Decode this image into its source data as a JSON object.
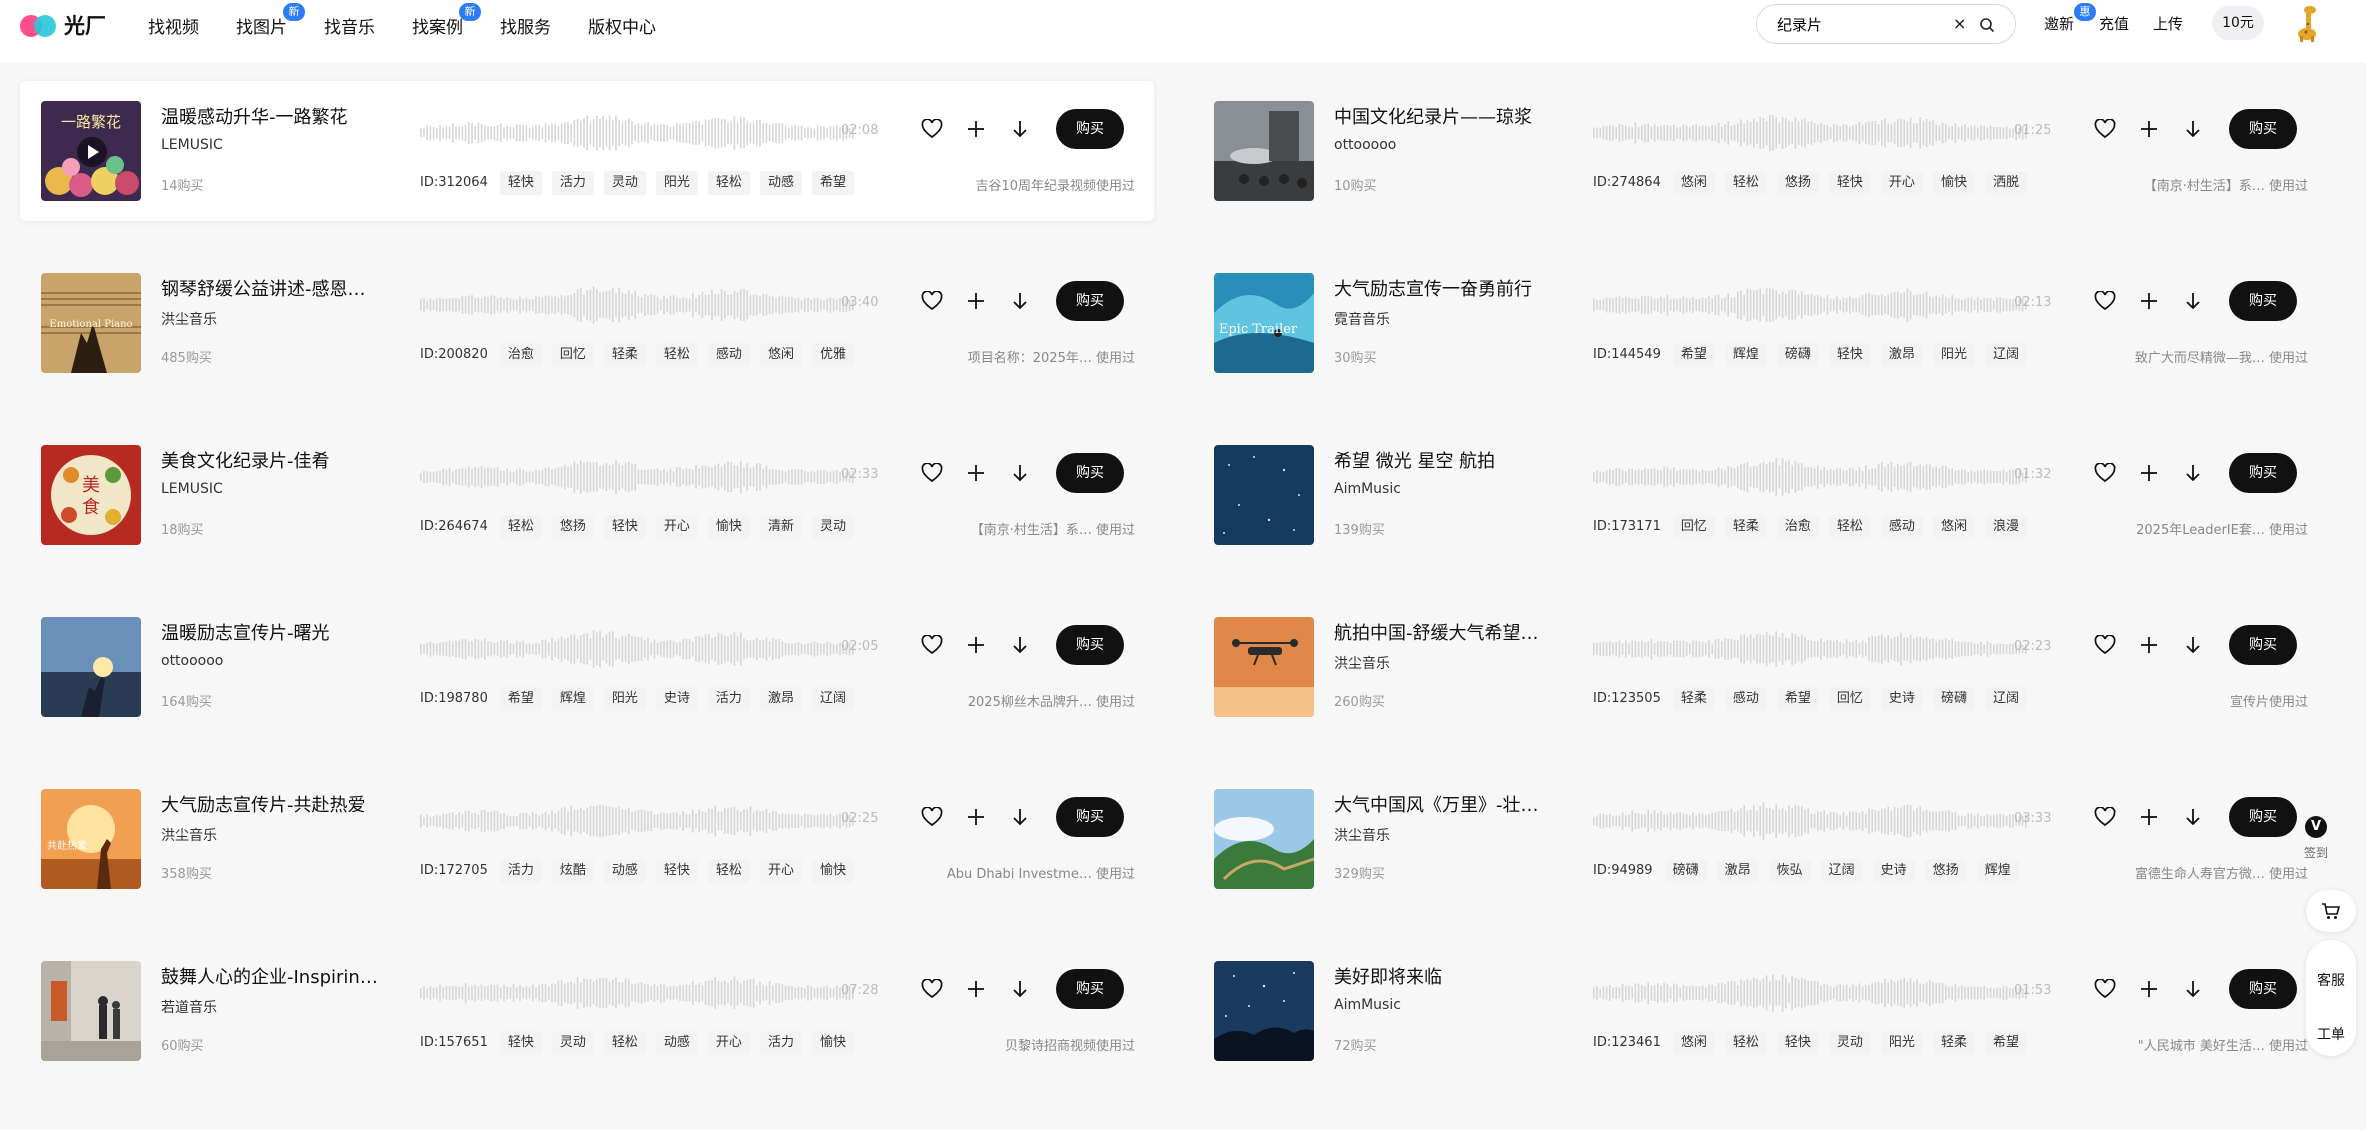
{
  "header": {
    "logo_text": "光厂",
    "nav": [
      {
        "label": "找视频",
        "badge": ""
      },
      {
        "label": "找图片",
        "badge": "新"
      },
      {
        "label": "找音乐",
        "badge": ""
      },
      {
        "label": "找案例",
        "badge": "新"
      },
      {
        "label": "找服务",
        "badge": ""
      },
      {
        "label": "版权中心",
        "badge": ""
      }
    ],
    "search_value": "纪录片",
    "search_clear": "×",
    "invite_label": "邀新",
    "invite_badge": "惠",
    "recharge_label": "充值",
    "upload_label": "上传",
    "balance": "10元"
  },
  "tracks": [
    {
      "title": "温暖感动升华-一路繁花",
      "author": "LEMUSIC",
      "buys": "14购买",
      "duration": "02:08",
      "id": "ID:312064",
      "tags": [
        "轻快",
        "活力",
        "灵动",
        "阳光",
        "轻松",
        "动感",
        "希望"
      ],
      "usage_text": "吉谷10周年纪录视频使用过",
      "usage_suffix": ""
    },
    {
      "title": "中国文化纪录片——琼浆",
      "author": "ottooooo",
      "buys": "10购买",
      "duration": "01:25",
      "id": "ID:274864",
      "tags": [
        "悠闲",
        "轻松",
        "悠扬",
        "轻快",
        "开心",
        "愉快",
        "洒脱"
      ],
      "usage_text": "【南京·村生活】系…",
      "usage_suffix": "使用过"
    },
    {
      "title": "钢琴舒缓公益讲述-感恩…",
      "author": "洪尘音乐",
      "buys": "485购买",
      "duration": "03:40",
      "id": "ID:200820",
      "tags": [
        "治愈",
        "回忆",
        "轻柔",
        "轻松",
        "感动",
        "悠闲",
        "优雅"
      ],
      "usage_text": "项目名称：2025年…",
      "usage_suffix": "使用过"
    },
    {
      "title": "大气励志宣传一奋勇前行",
      "author": "霓音音乐",
      "buys": "30购买",
      "duration": "02:13",
      "id": "ID:144549",
      "tags": [
        "希望",
        "辉煌",
        "磅礴",
        "轻快",
        "激昂",
        "阳光",
        "辽阔"
      ],
      "usage_text": "致广大而尽精微—我…",
      "usage_suffix": "使用过"
    },
    {
      "title": "美食文化纪录片-佳肴",
      "author": "LEMUSIC",
      "buys": "18购买",
      "duration": "02:33",
      "id": "ID:264674",
      "tags": [
        "轻松",
        "悠扬",
        "轻快",
        "开心",
        "愉快",
        "清新",
        "灵动"
      ],
      "usage_text": "【南京·村生活】系…",
      "usage_suffix": "使用过"
    },
    {
      "title": "希望 微光 星空 航拍",
      "author": "AimMusic",
      "buys": "139购买",
      "duration": "01:32",
      "id": "ID:173171",
      "tags": [
        "回忆",
        "轻柔",
        "治愈",
        "轻松",
        "感动",
        "悠闲",
        "浪漫"
      ],
      "usage_text": "2025年LeaderIE套…",
      "usage_suffix": "使用过"
    },
    {
      "title": "温暖励志宣传片-曙光",
      "author": "ottooooo",
      "buys": "164购买",
      "duration": "02:05",
      "id": "ID:198780",
      "tags": [
        "希望",
        "辉煌",
        "阳光",
        "史诗",
        "活力",
        "激昂",
        "辽阔"
      ],
      "usage_text": "2025柳丝木品牌升…",
      "usage_suffix": "使用过"
    },
    {
      "title": "航拍中国-舒缓大气希望…",
      "author": "洪尘音乐",
      "buys": "260购买",
      "duration": "02:23",
      "id": "ID:123505",
      "tags": [
        "轻柔",
        "感动",
        "希望",
        "回忆",
        "史诗",
        "磅礴",
        "辽阔"
      ],
      "usage_text": "宣传片使用过",
      "usage_suffix": ""
    },
    {
      "title": "大气励志宣传片-共赴热爱",
      "author": "洪尘音乐",
      "buys": "358购买",
      "duration": "02:25",
      "id": "ID:172705",
      "tags": [
        "活力",
        "炫酷",
        "动感",
        "轻快",
        "轻松",
        "开心",
        "愉快"
      ],
      "usage_text": "Abu Dhabi Investme…",
      "usage_suffix": "使用过"
    },
    {
      "title": "大气中国风《万里》-壮…",
      "author": "洪尘音乐",
      "buys": "329购买",
      "duration": "03:33",
      "id": "ID:94989",
      "tags": [
        "磅礴",
        "激昂",
        "恢弘",
        "辽阔",
        "史诗",
        "悠扬",
        "辉煌"
      ],
      "usage_text": "富德生命人寿官方微…",
      "usage_suffix": "使用过"
    },
    {
      "title": "鼓舞人心的企业-Inspirin…",
      "author": "若道音乐",
      "buys": "60购买",
      "duration": "07:28",
      "id": "ID:157651",
      "tags": [
        "轻快",
        "灵动",
        "轻松",
        "动感",
        "开心",
        "活力",
        "愉快"
      ],
      "usage_text": "贝黎诗招商视频使用过",
      "usage_suffix": ""
    },
    {
      "title": "美好即将来临",
      "author": "AimMusic",
      "buys": "72购买",
      "duration": "01:53",
      "id": "ID:123461",
      "tags": [
        "悠闲",
        "轻松",
        "轻快",
        "灵动",
        "阳光",
        "轻柔",
        "希望"
      ],
      "usage_text": "\"人民城市 美好生活…",
      "usage_suffix": "使用过"
    }
  ],
  "thumb_text": {
    "t0": "一路繁花",
    "t2": "Emotional Piano",
    "t3": "Epic Trailer",
    "t4_a": "美",
    "t4_b": "食",
    "t8": "共赴热爱"
  },
  "buy_label": "购买",
  "sidebar": {
    "vip_letter": "V",
    "checkin_label": "签到",
    "support_label": "客服",
    "ticket_label": "工单"
  },
  "colors": {
    "accent": "#2b7cf5",
    "buy_button": "#111111"
  }
}
